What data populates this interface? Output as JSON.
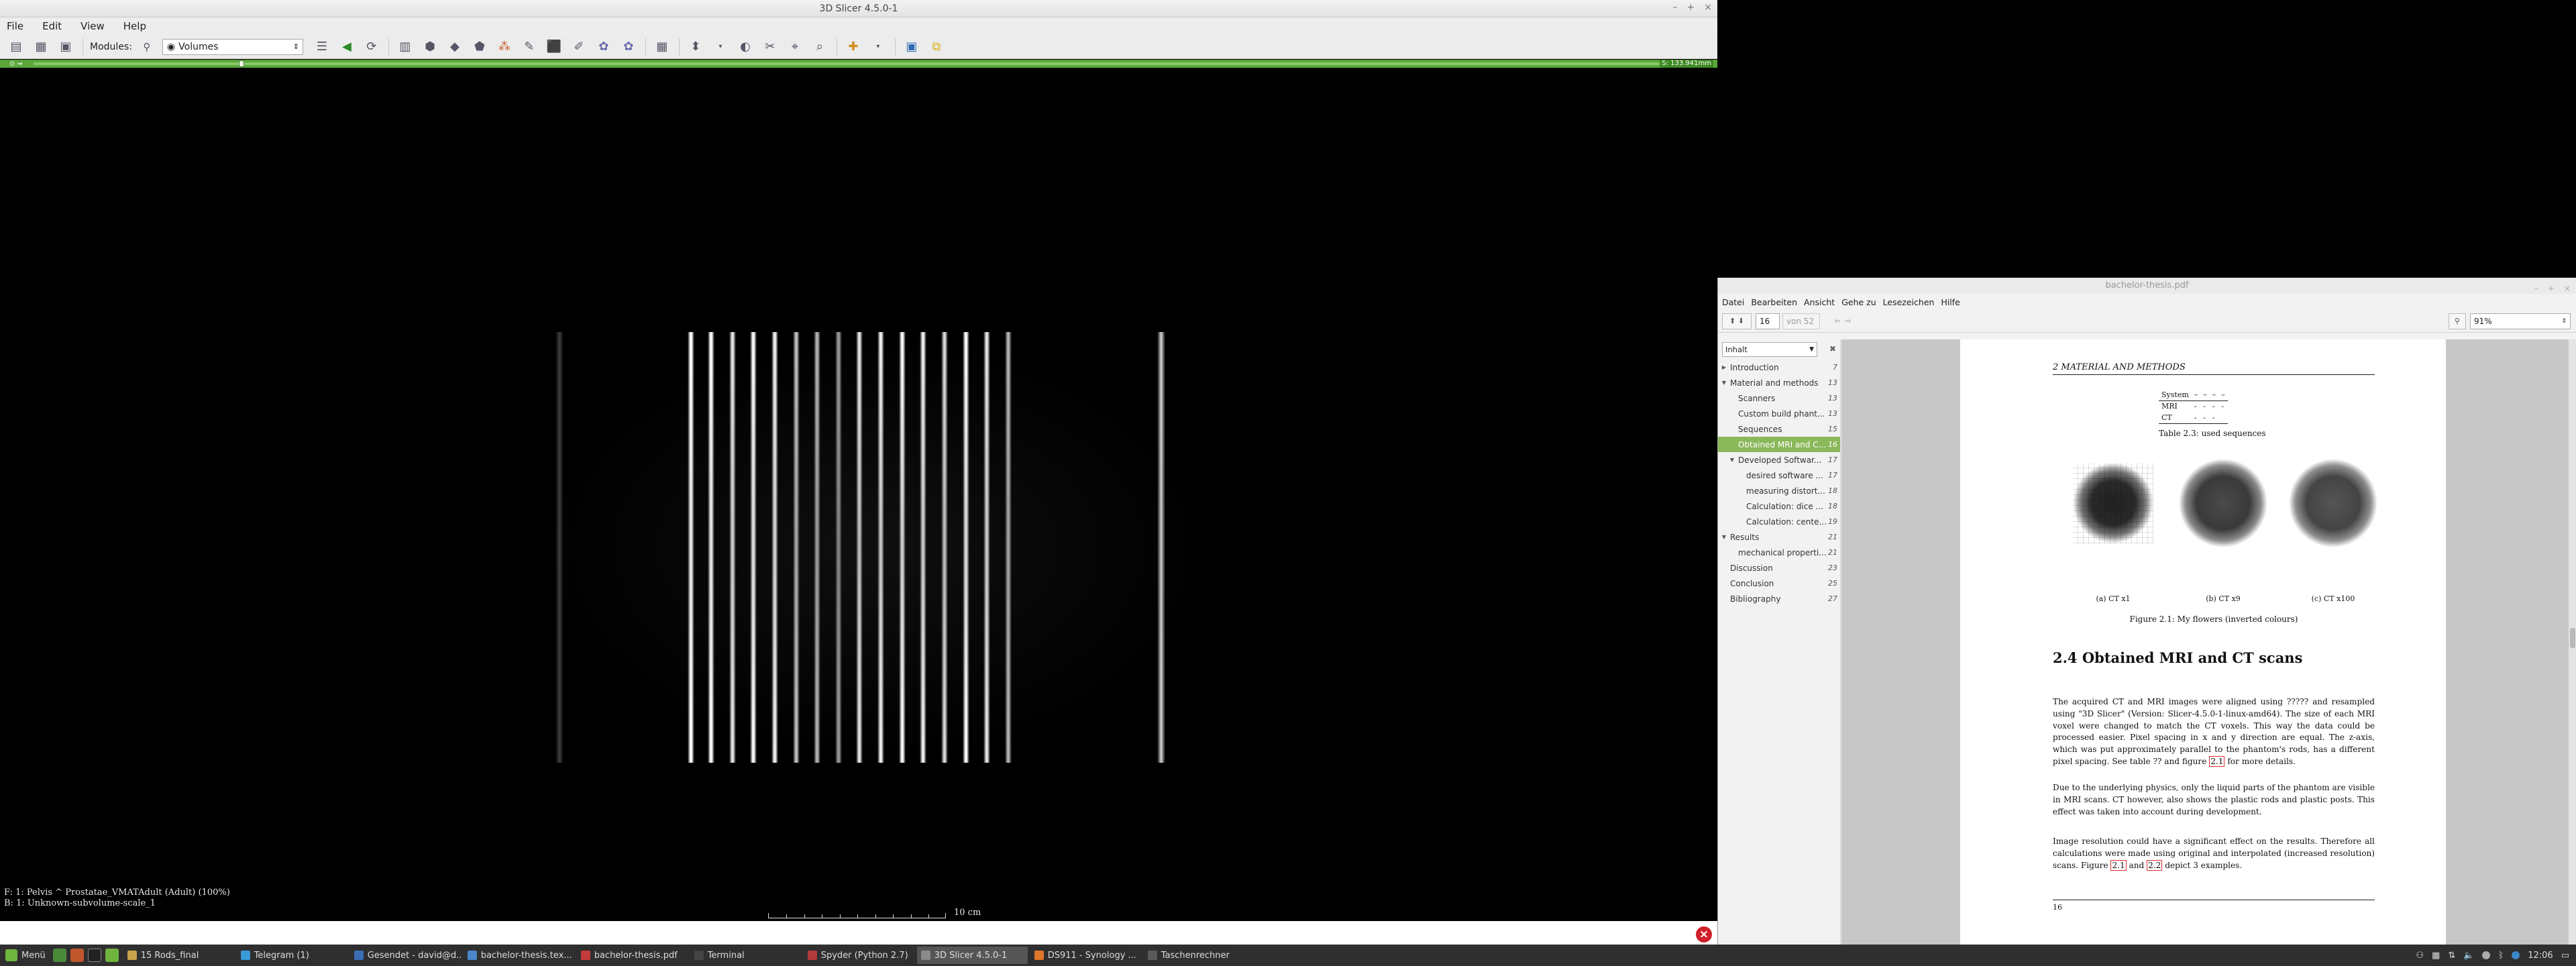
{
  "slicer": {
    "window_title": "3D Slicer 4.5.0-1",
    "menu": [
      "File",
      "Edit",
      "View",
      "Help"
    ],
    "toolbar": {
      "modules_label": "Modules:",
      "module_selected": "Volumes"
    },
    "slider_label": "S: 133.941mm",
    "viewport": {
      "info_line_1": "F: 1: Pelvis ^ Prostatae_VMATAdult (Adult) (100%)",
      "info_line_2": "B: 1: Unknown-subvolume-scale_1",
      "ruler_label": "10 cm"
    }
  },
  "pdf": {
    "window_title": "bachelor-thesis.pdf",
    "menu": [
      "Datei",
      "Bearbeiten",
      "Ansicht",
      "Gehe zu",
      "Lesezeichen",
      "Hilfe"
    ],
    "page_current": "16",
    "page_total": "von 52",
    "zoom": "91%",
    "sidebar_mode": "Inhalt",
    "toc": [
      {
        "label": "Introduction",
        "page": "7",
        "level": 0,
        "expander": "▶",
        "selected": false
      },
      {
        "label": "Material and methods",
        "page": "13",
        "level": 0,
        "expander": "▼",
        "selected": false
      },
      {
        "label": "Scanners",
        "page": "13",
        "level": 1,
        "expander": "",
        "selected": false
      },
      {
        "label": "Custom build phant...",
        "page": "13",
        "level": 1,
        "expander": "",
        "selected": false
      },
      {
        "label": "Sequences",
        "page": "15",
        "level": 1,
        "expander": "",
        "selected": false
      },
      {
        "label": "Obtained MRI and C...",
        "page": "16",
        "level": 1,
        "expander": "",
        "selected": true
      },
      {
        "label": "Developed Softwar...",
        "page": "17",
        "level": 1,
        "expander": "▼",
        "selected": false
      },
      {
        "label": "desired software ...",
        "page": "17",
        "level": 2,
        "expander": "",
        "selected": false
      },
      {
        "label": "measuring distort...",
        "page": "18",
        "level": 2,
        "expander": "",
        "selected": false
      },
      {
        "label": "Calculation: dice ...",
        "page": "18",
        "level": 2,
        "expander": "",
        "selected": false
      },
      {
        "label": "Calculation: cente...",
        "page": "19",
        "level": 2,
        "expander": "",
        "selected": false
      },
      {
        "label": "Results",
        "page": "21",
        "level": 0,
        "expander": "▼",
        "selected": false
      },
      {
        "label": "mechanical properti...",
        "page": "21",
        "level": 1,
        "expander": "",
        "selected": false
      },
      {
        "label": "Discussion",
        "page": "23",
        "level": 0,
        "expander": "",
        "selected": false
      },
      {
        "label": "Conclusion",
        "page": "25",
        "level": 0,
        "expander": "",
        "selected": false
      },
      {
        "label": "Bibliography",
        "page": "27",
        "level": 0,
        "expander": "",
        "selected": false
      }
    ],
    "page": {
      "running_head": "2  MATERIAL AND METHODS",
      "table": {
        "header": "System",
        "rows": [
          "MRI",
          "CT"
        ],
        "caption": "Table 2.3: used sequences"
      },
      "figure": {
        "subcaptions": [
          "(a) CT x1",
          "(b) CT x9",
          "(c) CT x100"
        ],
        "caption": "Figure 2.1: My flowers (inverted colours)"
      },
      "section": "2.4  Obtained MRI and CT scans",
      "para1": {
        "text": "The acquired CT and MRI images were aligned using ????? and resampled using \"3D Slicer\" (Version: Slicer-4.5.0-1-linux-amd64). The size of each MRI voxel were changed to match the CT voxels. This way the data could be processed easier. Pixel spacing in x and y direction are equal. The z-axis, which was put approximately parallel to the phantom's rods, has a different pixel spacing. See table ?? and figure",
        "ref": "2.1",
        "tail": " for more details."
      },
      "para2": "Due to the underlying physics, only the liquid parts of the phantom are visible in MRI scans. CT however, also shows the plastic rods and plastic posts. This effect was taken into account during development.",
      "para3": {
        "text": "Image resolution could have a significant effect on the results. Therefore all calculations were made using original and interpolated (increased resolution) scans. Figure ",
        "ref1": "2.1",
        "mid": " and ",
        "ref2": "2.2",
        "tail": " depict 3 examples."
      },
      "page_number": "16"
    }
  },
  "taskbar": {
    "menu_label": "Menü",
    "tasks": [
      {
        "label": "15 Rods_final",
        "active": false,
        "color": "#c9a24a"
      },
      {
        "label": "Telegram (1)",
        "active": false,
        "color": "#3a9ad9"
      },
      {
        "label": "Gesendet - david@d...",
        "active": false,
        "color": "#3a6fb5"
      },
      {
        "label": "bachelor-thesis.tex...",
        "active": false,
        "color": "#4b87c9"
      },
      {
        "label": "bachelor-thesis.pdf",
        "active": false,
        "color": "#c43b3b"
      },
      {
        "label": "Terminal",
        "active": false,
        "color": "#444444"
      },
      {
        "label": "Spyder (Python 2.7)",
        "active": false,
        "color": "#b33a3a"
      },
      {
        "label": "3D Slicer 4.5.0-1",
        "active": true,
        "color": "#8a8a8a"
      },
      {
        "label": "DS911 - Synology ...",
        "active": false,
        "color": "#e0762b"
      },
      {
        "label": "Taschenrechner",
        "active": false,
        "color": "#5a5a5a"
      }
    ],
    "clock": "12:06"
  }
}
